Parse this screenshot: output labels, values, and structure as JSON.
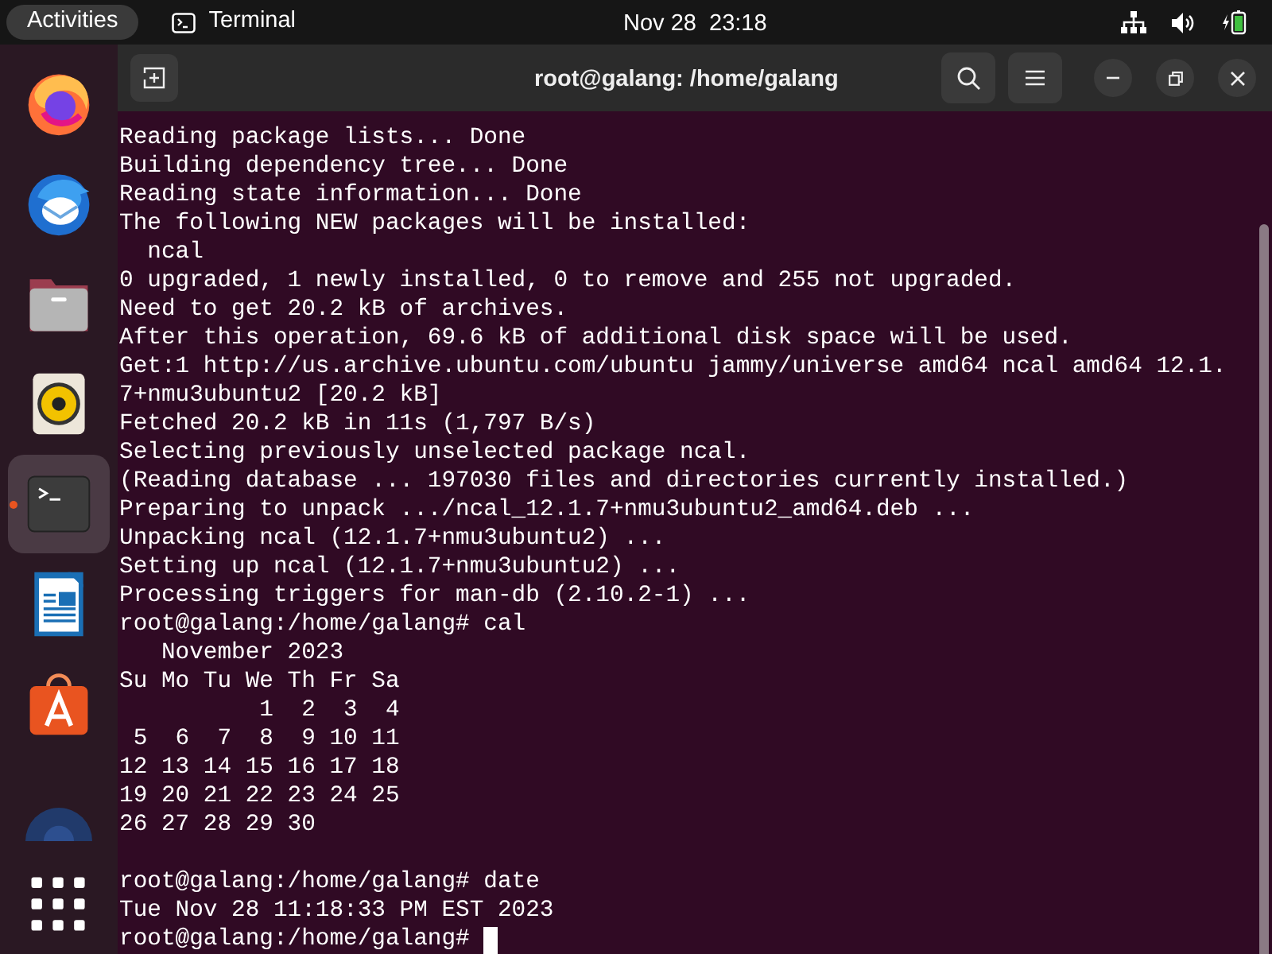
{
  "top_bar": {
    "activities": "Activities",
    "app_name": "Terminal",
    "clock": "Nov 28  23:18"
  },
  "dock": {
    "items": [
      {
        "kind": "firefox",
        "active": false
      },
      {
        "kind": "thunderbird",
        "active": false
      },
      {
        "kind": "files",
        "active": false
      },
      {
        "kind": "rhythmbox",
        "active": false
      },
      {
        "kind": "terminal",
        "active": true
      },
      {
        "kind": "writer",
        "active": false
      },
      {
        "kind": "appcenter",
        "active": false
      },
      {
        "kind": "help",
        "active": false
      },
      {
        "kind": "apps",
        "active": false
      }
    ]
  },
  "window": {
    "title": "root@galang: /home/galang"
  },
  "terminal": {
    "lines": [
      {
        "text": "Reading package lists... Done"
      },
      {
        "text": "Building dependency tree... Done"
      },
      {
        "text": "Reading state information... Done"
      },
      {
        "text": "The following NEW packages will be installed:"
      },
      {
        "text": "  ncal"
      },
      {
        "text": "0 upgraded, 1 newly installed, 0 to remove and 255 not upgraded."
      },
      {
        "text": "Need to get 20.2 kB of archives."
      },
      {
        "text": "After this operation, 69.6 kB of additional disk space will be used."
      },
      {
        "text": "Get:1 http://us.archive.ubuntu.com/ubuntu jammy/universe amd64 ncal amd64 12.1."
      },
      {
        "text": "7+nmu3ubuntu2 [20.2 kB]"
      },
      {
        "text": "Fetched 20.2 kB in 11s (1,797 B/s)"
      },
      {
        "text": "Selecting previously unselected package ncal."
      },
      {
        "text": "(Reading database ... 197030 files and directories currently installed.)"
      },
      {
        "text": "Preparing to unpack .../ncal_12.1.7+nmu3ubuntu2_amd64.deb ..."
      },
      {
        "text": "Unpacking ncal (12.1.7+nmu3ubuntu2) ..."
      },
      {
        "text": "Setting up ncal (12.1.7+nmu3ubuntu2) ..."
      },
      {
        "text": "Processing triggers for man-db (2.10.2-1) ..."
      },
      {
        "text": "root@galang:/home/galang# cal"
      },
      {
        "text": "   November 2023"
      },
      {
        "text": "Su Mo Tu We Th Fr Sa"
      },
      {
        "text": "          1  2  3  4"
      },
      {
        "text": " 5  6  7  8  9 10 11"
      },
      {
        "text": "12 13 14 15 16 17 18"
      },
      {
        "text": "19 20 21 22 23 24 25"
      },
      {
        "text": "26 27 28 29 30"
      },
      {
        "kind": "blank"
      },
      {
        "text": "root@galang:/home/galang# date"
      },
      {
        "text": "Tue Nov 28 11:18:33 PM EST 2023"
      },
      {
        "text": "root@galang:/home/galang# ",
        "cursor": true
      }
    ]
  }
}
